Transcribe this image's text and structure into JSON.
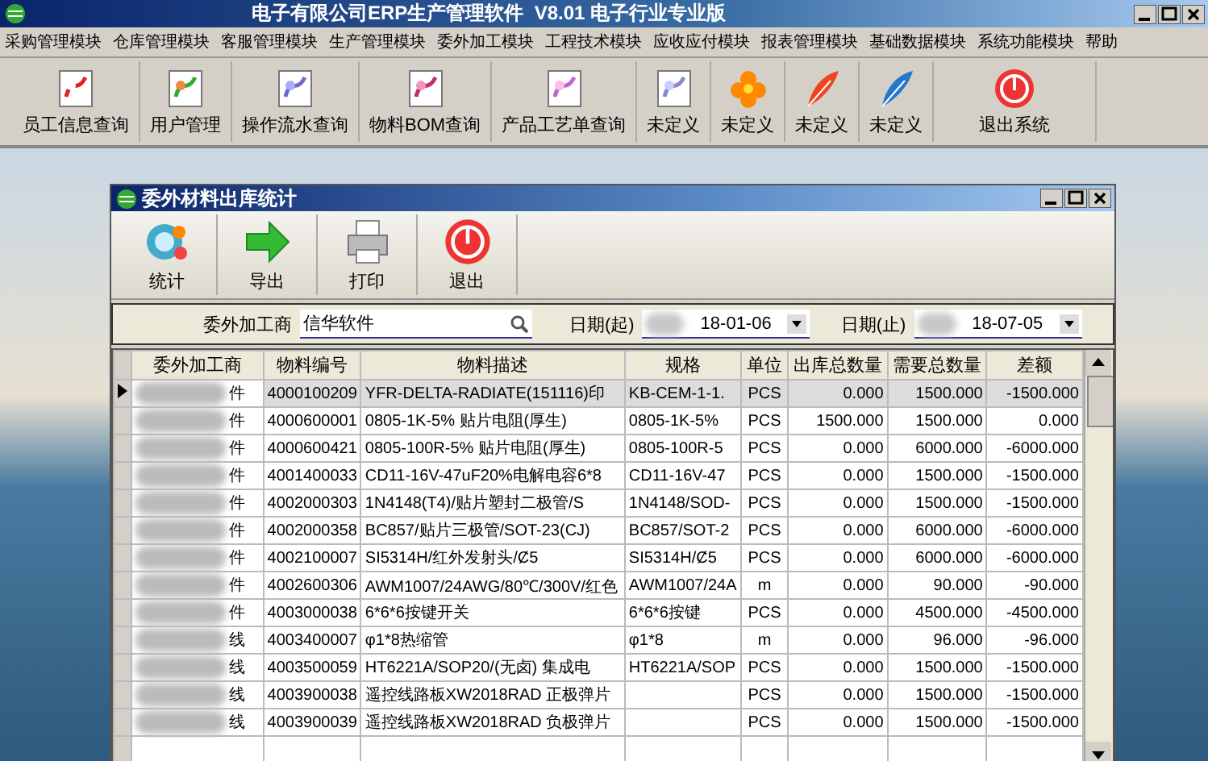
{
  "window": {
    "title": "电子有限公司ERP生产管理软件  V8.01 电子行业专业版"
  },
  "menu": [
    "采购管理模块",
    "仓库管理模块",
    "客服管理模块",
    "生产管理模块",
    "委外加工模块",
    "工程技术模块",
    "应收应付模块",
    "报表管理模块",
    "基础数据模块",
    "系统功能模块",
    "帮助"
  ],
  "toolbar": [
    "员工信息查询",
    "用户管理",
    "操作流水查询",
    "物料BOM查询",
    "产品工艺单查询",
    "未定义",
    "未定义",
    "未定义",
    "未定义",
    "退出系统"
  ],
  "child_window": {
    "title": "委外材料出库统计",
    "toolbar": [
      "统计",
      "导出",
      "打印",
      "退出"
    ],
    "filter": {
      "supplier_label": "委外加工商",
      "supplier_value": "信华软件",
      "start_label": "日期(起)",
      "start_value": "18-01-06",
      "end_label": "日期(止)",
      "end_value": "18-07-05"
    },
    "table": {
      "columns": [
        "委外加工商",
        "物料编号",
        "物料描述",
        "规格",
        "单位",
        "出库总数量",
        "需要总数量",
        "差额"
      ],
      "rows": [
        {
          "selected": true,
          "cells": [
            "件",
            "4000100209",
            "YFR-DELTA-RADIATE(151116)印",
            "KB-CEM-1-1.",
            "PCS",
            "0.000",
            "1500.000",
            "-1500.000"
          ]
        },
        {
          "selected": false,
          "cells": [
            "件",
            "4000600001",
            "0805-1K-5% 贴片电阻(厚生)",
            "0805-1K-5%",
            "PCS",
            "1500.000",
            "1500.000",
            "0.000"
          ]
        },
        {
          "selected": false,
          "cells": [
            "件",
            "4000600421",
            "0805-100R-5% 贴片电阻(厚生)",
            "0805-100R-5",
            "PCS",
            "0.000",
            "6000.000",
            "-6000.000"
          ]
        },
        {
          "selected": false,
          "cells": [
            "件",
            "4001400033",
            "CD11-16V-47uF20%电解电容6*8",
            "CD11-16V-47",
            "PCS",
            "0.000",
            "1500.000",
            "-1500.000"
          ]
        },
        {
          "selected": false,
          "cells": [
            "件",
            "4002000303",
            "1N4148(T4)/贴片塑封二极管/S",
            "1N4148/SOD-",
            "PCS",
            "0.000",
            "1500.000",
            "-1500.000"
          ]
        },
        {
          "selected": false,
          "cells": [
            "件",
            "4002000358",
            "BC857/贴片三极管/SOT-23(CJ)",
            "BC857/SOT-2",
            "PCS",
            "0.000",
            "6000.000",
            "-6000.000"
          ]
        },
        {
          "selected": false,
          "cells": [
            "件",
            "4002100007",
            "SI5314H/红外发射头/Ȼ5",
            "SI5314H/Ȼ5",
            "PCS",
            "0.000",
            "6000.000",
            "-6000.000"
          ]
        },
        {
          "selected": false,
          "cells": [
            "件",
            "4002600306",
            "AWM1007/24AWG/80℃/300V/红色",
            "AWM1007/24A",
            "m",
            "0.000",
            "90.000",
            "-90.000"
          ]
        },
        {
          "selected": false,
          "cells": [
            "件",
            "4003000038",
            "6*6*6按键开关",
            "6*6*6按键",
            "PCS",
            "0.000",
            "4500.000",
            "-4500.000"
          ]
        },
        {
          "selected": false,
          "cells": [
            "线",
            "4003400007",
            "φ1*8热缩管",
            "φ1*8",
            "m",
            "0.000",
            "96.000",
            "-96.000"
          ]
        },
        {
          "selected": false,
          "cells": [
            "线",
            "4003500059",
            "HT6221A/SOP20/(无卤) 集成电",
            "HT6221A/SOP",
            "PCS",
            "0.000",
            "1500.000",
            "-1500.000"
          ]
        },
        {
          "selected": false,
          "cells": [
            "线",
            "4003900038",
            "遥控线路板XW2018RAD 正极弹片",
            "",
            "PCS",
            "0.000",
            "1500.000",
            "-1500.000"
          ]
        },
        {
          "selected": false,
          "cells": [
            "线",
            "4003900039",
            "遥控线路板XW2018RAD 负极弹片",
            "",
            "PCS",
            "0.000",
            "1500.000",
            "-1500.000"
          ]
        }
      ]
    }
  }
}
